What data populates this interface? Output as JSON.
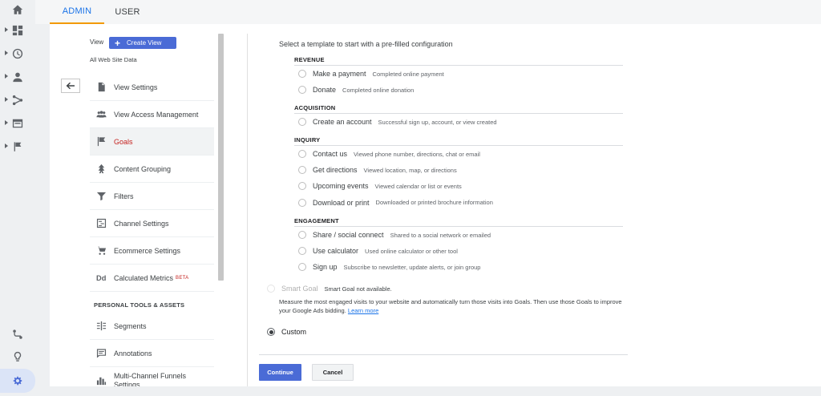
{
  "tabs": {
    "admin": "ADMIN",
    "user": "USER"
  },
  "rail": {
    "items": [
      "home-icon",
      "dashboards-icon",
      "clock-icon",
      "person-icon",
      "acquisition-icon",
      "behavior-icon",
      "flag-icon"
    ],
    "bottom": [
      "route-icon",
      "lightbulb-icon",
      "gear-icon"
    ]
  },
  "view": {
    "label": "View",
    "create_button": "Create View",
    "create_plus": "+",
    "current": "All Web Site Data"
  },
  "menu": {
    "items": [
      {
        "label": "View Settings",
        "icon": "document-icon"
      },
      {
        "label": "View Access Management",
        "icon": "people-icon"
      },
      {
        "label": "Goals",
        "icon": "flag-icon",
        "selected": true
      },
      {
        "label": "Content Grouping",
        "icon": "content-grouping-icon"
      },
      {
        "label": "Filters",
        "icon": "filter-icon"
      },
      {
        "label": "Channel Settings",
        "icon": "channel-icon"
      },
      {
        "label": "Ecommerce Settings",
        "icon": "cart-icon"
      },
      {
        "label": "Calculated Metrics",
        "icon": "dd-icon",
        "badge": "BETA"
      }
    ],
    "section": "PERSONAL TOOLS & ASSETS",
    "tools": [
      {
        "label": "Segments",
        "icon": "segments-icon"
      },
      {
        "label": "Annotations",
        "icon": "annotation-icon"
      },
      {
        "label": "Multi-Channel Funnels Settings",
        "icon": "bar-chart-icon"
      }
    ]
  },
  "goals": {
    "intro": "Select a template to start with a pre-filled configuration",
    "groups": [
      {
        "title": "REVENUE",
        "options": [
          {
            "name": "Make a payment",
            "desc": "Completed online payment"
          },
          {
            "name": "Donate",
            "desc": "Completed online donation"
          }
        ]
      },
      {
        "title": "ACQUISITION",
        "options": [
          {
            "name": "Create an account",
            "desc": "Successful sign up, account, or view created"
          }
        ]
      },
      {
        "title": "INQUIRY",
        "options": [
          {
            "name": "Contact us",
            "desc": "Viewed phone number, directions, chat or email"
          },
          {
            "name": "Get directions",
            "desc": "Viewed location, map, or directions"
          },
          {
            "name": "Upcoming events",
            "desc": "Viewed calendar or list or events"
          },
          {
            "name": "Download or print",
            "desc": "Downloaded or printed brochure information"
          }
        ]
      },
      {
        "title": "ENGAGEMENT",
        "options": [
          {
            "name": "Share / social connect",
            "desc": "Shared to a social network or emailed"
          },
          {
            "name": "Use calculator",
            "desc": "Used online calculator or other tool"
          },
          {
            "name": "Sign up",
            "desc": "Subscribe to newsletter, update alerts, or join group"
          }
        ]
      }
    ],
    "smart": {
      "name": "Smart Goal",
      "status": "Smart Goal not available.",
      "desc": "Measure the most engaged visits to your website and automatically turn those visits into Goals. Then use those Goals to improve your Google Ads bidding.",
      "learn_more": "Learn more"
    },
    "custom": {
      "name": "Custom",
      "selected": true
    }
  },
  "actions": {
    "continue": "Continue",
    "cancel": "Cancel"
  },
  "colors": {
    "accent": "#4a6bd6",
    "selected_text": "#c5221f",
    "tab_underline": "#f29900"
  }
}
